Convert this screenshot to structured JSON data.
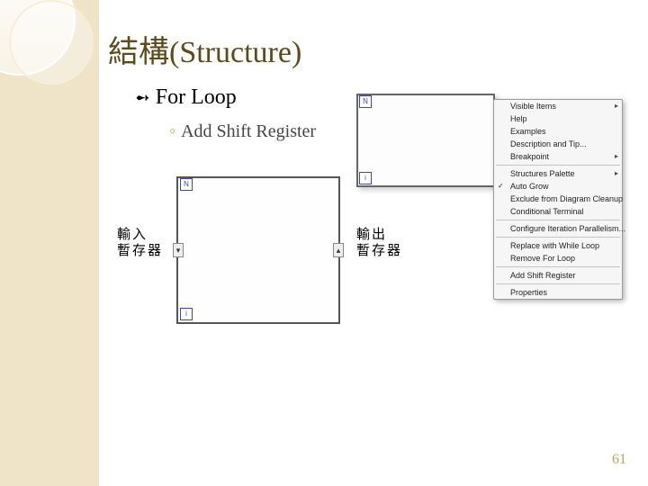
{
  "slide": {
    "title": "結構(Structure)",
    "heading": "For Loop",
    "subheading": "Add Shift Register",
    "page_number": "61"
  },
  "labels": {
    "input_register_line1": "輸入",
    "input_register_line2": "暫存器",
    "output_register_line1": "輸出",
    "output_register_line2": "暫存器"
  },
  "forloop": {
    "n_terminal": "N",
    "i_terminal": "i",
    "shift_left_glyph": "▾",
    "shift_right_glyph": "▴"
  },
  "context_menu": {
    "items": [
      {
        "label": "Visible Items",
        "sub": true
      },
      {
        "label": "Help"
      },
      {
        "label": "Examples"
      },
      {
        "label": "Description and Tip..."
      },
      {
        "label": "Breakpoint",
        "sub": true
      },
      {
        "sep": true
      },
      {
        "label": "Structures Palette",
        "sub": true
      },
      {
        "label": "Auto Grow",
        "check": true
      },
      {
        "label": "Exclude from Diagram Cleanup"
      },
      {
        "label": "Conditional Terminal"
      },
      {
        "sep": true
      },
      {
        "label": "Configure Iteration Parallelism..."
      },
      {
        "sep": true
      },
      {
        "label": "Replace with While Loop"
      },
      {
        "label": "Remove For Loop"
      },
      {
        "sep": true
      },
      {
        "label": "Add Shift Register"
      },
      {
        "sep": true
      },
      {
        "label": "Properties"
      }
    ]
  }
}
